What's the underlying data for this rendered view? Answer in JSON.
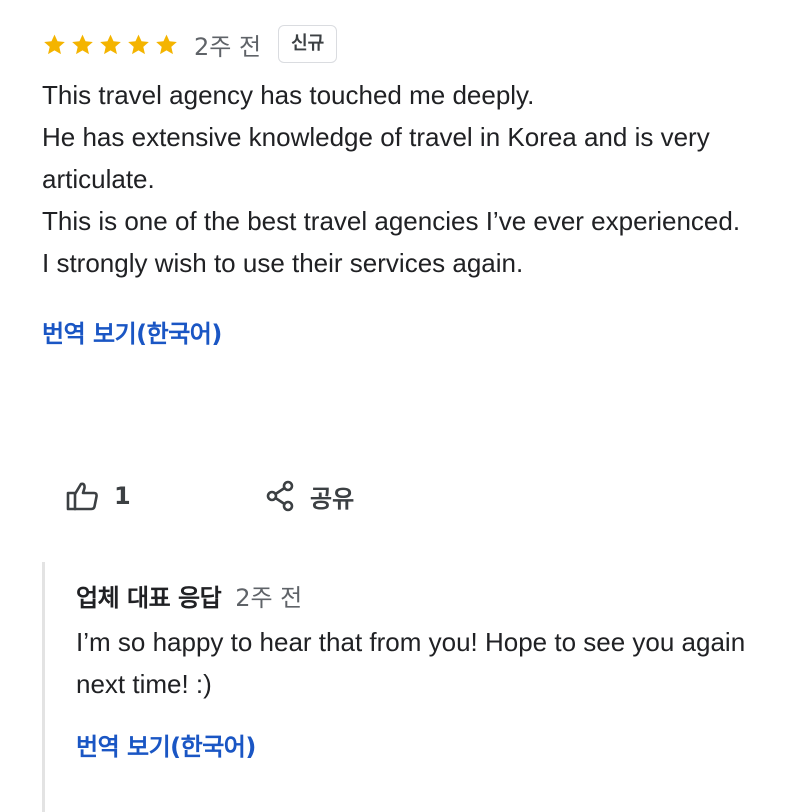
{
  "review": {
    "rating": 5,
    "max_rating": 5,
    "star_color": "#f4b400",
    "star_icon": "star-icon",
    "time_ago": "2주 전",
    "badge": "신규",
    "text": "This travel agency has touched me deeply.\nHe has extensive knowledge of travel in Korea and is very articulate.\nThis is one of the best travel agencies I’ve ever experienced. I strongly wish to use their services again.",
    "translate_link": "번역 보기(한국어)"
  },
  "actions": {
    "like_icon": "thumbs-up-icon",
    "like_count": "1",
    "share_icon": "share-icon",
    "share_label": "공유"
  },
  "owner_response": {
    "title": "업체 대표 응답",
    "time_ago": "2주 전",
    "text": "I’m so happy to hear that from you! Hope to see you again next time! :)",
    "translate_link": "번역 보기(한국어)",
    "accent_color": "#1a56c4"
  }
}
